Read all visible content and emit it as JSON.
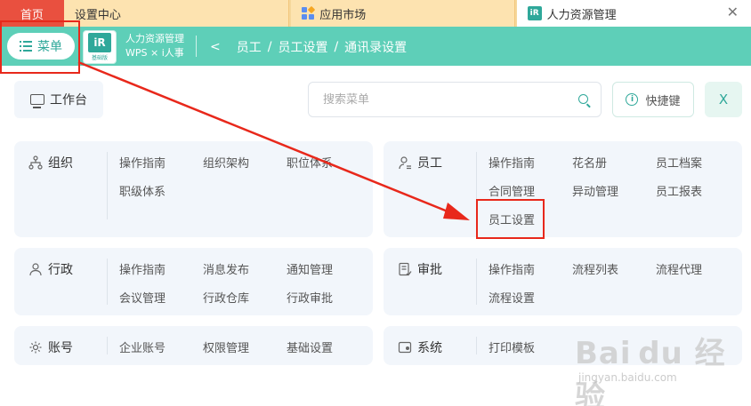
{
  "tabs": {
    "home": "首页",
    "settings": "设置中心",
    "market": "应用市场",
    "hr": "人力资源管理"
  },
  "header": {
    "menu_label": "菜单",
    "app_logo_text": "iR",
    "app_logo_sub": "基础版",
    "app_name_line1": "人力资源管理",
    "app_name_line2": "WPS × i人事",
    "breadcrumb": [
      "员工",
      "员工设置",
      "通讯录设置"
    ],
    "breadcrumb_sep": "/"
  },
  "toolbar": {
    "workbench_label": "工作台",
    "search_placeholder": "搜索菜单",
    "shortcut_label": "快捷键",
    "close_label": "X"
  },
  "sections": {
    "org": {
      "title": "组织",
      "items": [
        "操作指南",
        "组织架构",
        "职位体系",
        "职级体系"
      ]
    },
    "employee": {
      "title": "员工",
      "items": [
        "操作指南",
        "花名册",
        "员工档案",
        "合同管理",
        "异动管理",
        "员工报表",
        "员工设置"
      ]
    },
    "admin": {
      "title": "行政",
      "items": [
        "操作指南",
        "消息发布",
        "通知管理",
        "会议管理",
        "行政仓库",
        "行政审批"
      ]
    },
    "approval": {
      "title": "审批",
      "items": [
        "操作指南",
        "流程列表",
        "流程代理",
        "流程设置"
      ]
    },
    "account": {
      "title": "账号",
      "items": [
        "企业账号",
        "权限管理",
        "基础设置"
      ]
    },
    "system": {
      "title": "系统",
      "items": [
        "打印模板"
      ]
    }
  },
  "watermark": {
    "main": "Bai du 经验",
    "sub": "jingyan.baidu.com"
  },
  "colors": {
    "accent": "#5ecfb8",
    "accent_dark": "#2fa89a",
    "home_tab": "#e9503f",
    "tab_bar": "#f6d79b",
    "card_bg": "#f2f6fb",
    "annotation_red": "#e8281b"
  }
}
